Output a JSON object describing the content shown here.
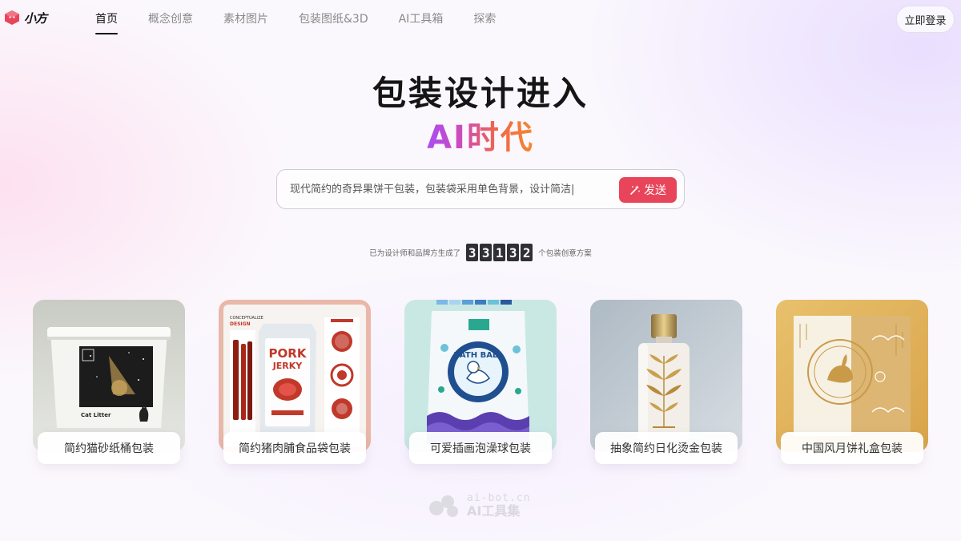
{
  "header": {
    "logo_text": "小方",
    "nav": [
      {
        "label": "首页",
        "active": true
      },
      {
        "label": "概念创意",
        "active": false
      },
      {
        "label": "素材图片",
        "active": false
      },
      {
        "label": "包装图纸&3D",
        "active": false
      },
      {
        "label": "AI工具箱",
        "active": false
      },
      {
        "label": "探索",
        "active": false
      }
    ],
    "login_label": "立即登录"
  },
  "hero": {
    "title": "包装设计进入",
    "subtitle": "AI时代"
  },
  "search": {
    "placeholder": "现代简约的奇异果饼干包装，包装袋采用单色背景，设计简洁|",
    "send_label": "发送"
  },
  "stats": {
    "prefix": "已为设计师和品牌方生成了",
    "digits": [
      "3",
      "3",
      "1",
      "3",
      "2"
    ],
    "suffix": "个包装创意方案"
  },
  "cards": [
    {
      "label": "简约猫砂纸桶包装",
      "art_text": [
        "Cat Litter"
      ]
    },
    {
      "label": "简约猪肉脯食品袋包装",
      "art_text": [
        "CONCEPTUALIZE",
        "DESIGN",
        "PORK",
        "JERKY"
      ]
    },
    {
      "label": "可爱插画泡澡球包装",
      "art_text": [
        "BATH BALL"
      ]
    },
    {
      "label": "抽象简约日化烫金包装",
      "art_text": []
    },
    {
      "label": "中国风月饼礼盒包装",
      "art_text": []
    }
  ],
  "watermark": {
    "url": "ai-bot.cn",
    "name": "AI工具集"
  },
  "colors": {
    "accent": "#e8455b",
    "brand_gradient": [
      "#a84ef2",
      "#f3892e"
    ],
    "digit_bg": "#2f2f35"
  }
}
